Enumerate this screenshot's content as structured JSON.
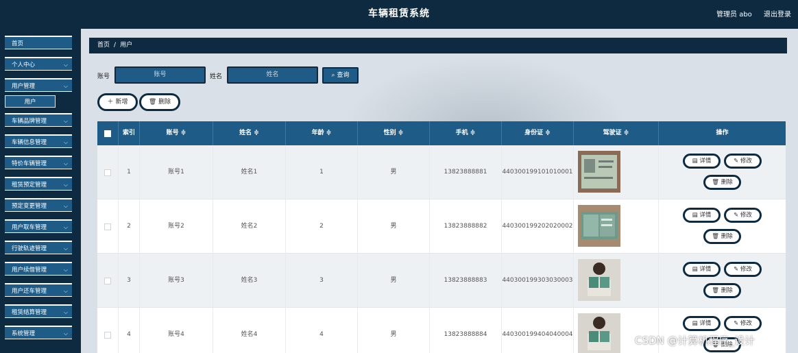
{
  "header": {
    "title": "车辆租赁系统",
    "user_label": "管理员 abo",
    "logout_label": "退出登录"
  },
  "sidebar": {
    "items": [
      {
        "label": "首页"
      },
      {
        "label": "个人中心"
      },
      {
        "label": "用户管理"
      },
      {
        "label": "车辆品牌管理"
      },
      {
        "label": "车辆信息管理"
      },
      {
        "label": "特价车辆管理"
      },
      {
        "label": "租赁预定管理"
      },
      {
        "label": "预定变更管理"
      },
      {
        "label": "用户取车管理"
      },
      {
        "label": "行驶轨迹管理"
      },
      {
        "label": "用户续借管理"
      },
      {
        "label": "用户还车管理"
      },
      {
        "label": "租赁结算管理"
      },
      {
        "label": "系统管理"
      }
    ],
    "sub_item": "用户"
  },
  "breadcrumb": {
    "home": "首页",
    "separator": "/",
    "current": "用户"
  },
  "search": {
    "account_label": "账号",
    "account_placeholder": "账号",
    "name_label": "姓名",
    "name_placeholder": "姓名",
    "query_label": "查询"
  },
  "actions": {
    "add_label": "新增",
    "delete_label": "删除"
  },
  "table": {
    "columns": [
      "索引",
      "账号 ≑",
      "姓名 ≑",
      "年龄 ≑",
      "性别 ≑",
      "手机 ≑",
      "身份证 ≑",
      "驾驶证 ≑",
      "操作"
    ],
    "rows": [
      {
        "index": "1",
        "account": "账号1",
        "name": "姓名1",
        "age": "1",
        "gender": "男",
        "phone": "13823888881",
        "id_card": "440300199101010001"
      },
      {
        "index": "2",
        "account": "账号2",
        "name": "姓名2",
        "age": "2",
        "gender": "男",
        "phone": "13823888882",
        "id_card": "440300199202020002"
      },
      {
        "index": "3",
        "account": "账号3",
        "name": "姓名3",
        "age": "3",
        "gender": "男",
        "phone": "13823888883",
        "id_card": "440300199303030003"
      },
      {
        "index": "4",
        "account": "账号4",
        "name": "姓名4",
        "age": "4",
        "gender": "男",
        "phone": "13823888884",
        "id_card": "440300199404040004"
      }
    ],
    "row_actions": {
      "detail": "详情",
      "edit": "修改",
      "delete": "删除"
    }
  },
  "watermark": "CSDN @计算机程序_设计",
  "colors": {
    "navy": "#0d2a40",
    "accent": "#1e5b86",
    "selection": "#2c7be5"
  }
}
